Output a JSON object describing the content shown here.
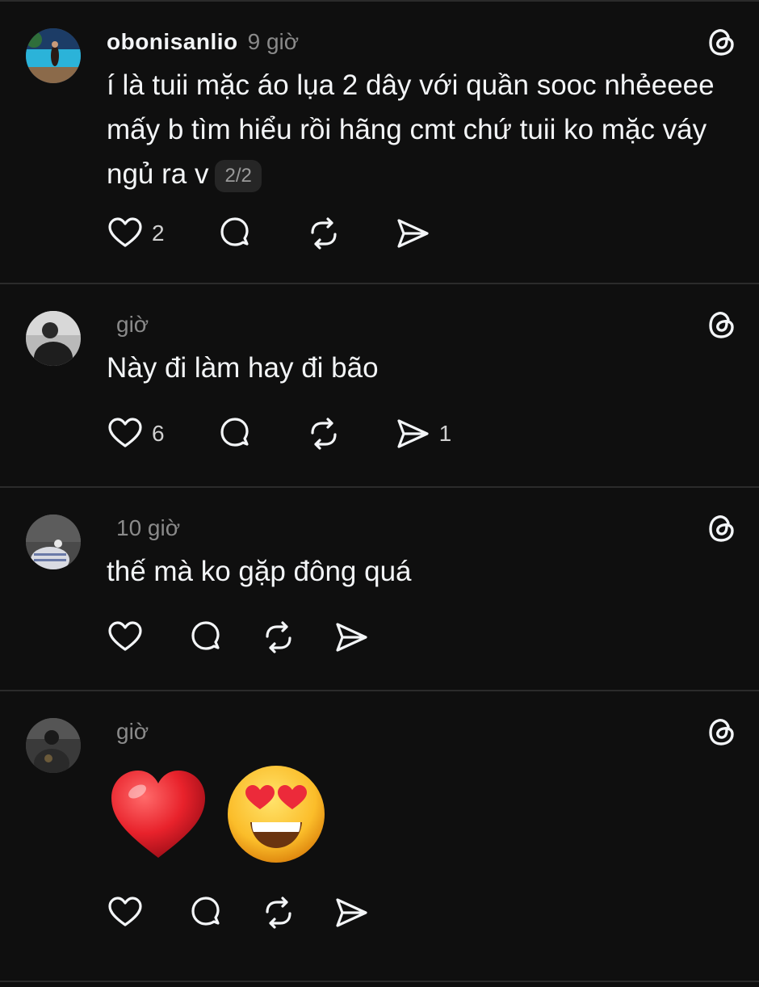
{
  "posts": [
    {
      "username": "obonisanlio",
      "time": "9 giờ",
      "text": "í là tuii mặc áo lụa 2 dây với quần sooc nhẻeeee mấy b tìm hiểu rồi hãng cmt chứ tuii ko mặc váy ngủ ra v",
      "badge": "2/2",
      "likes": "2",
      "shares": ""
    },
    {
      "username": "",
      "time": "giờ",
      "text": "Này đi làm hay đi bão",
      "likes": "6",
      "shares": "1"
    },
    {
      "username": "",
      "time": "10 giờ",
      "text": "thế mà ko gặp đông quá",
      "likes": "",
      "shares": ""
    },
    {
      "username": "",
      "time": "giờ",
      "text": "",
      "emojis": [
        "❤️",
        "😍"
      ],
      "likes": "",
      "shares": ""
    }
  ],
  "icons": {
    "like": "heart-icon",
    "reply": "comment-bubble-icon",
    "repost": "repost-icon",
    "share": "send-icon",
    "brand": "threads-logo-icon"
  },
  "colors": {
    "background": "#0f0f0f",
    "text": "#f3f5f7",
    "muted": "#8a8a8a",
    "divider": "#2b2b2b"
  }
}
